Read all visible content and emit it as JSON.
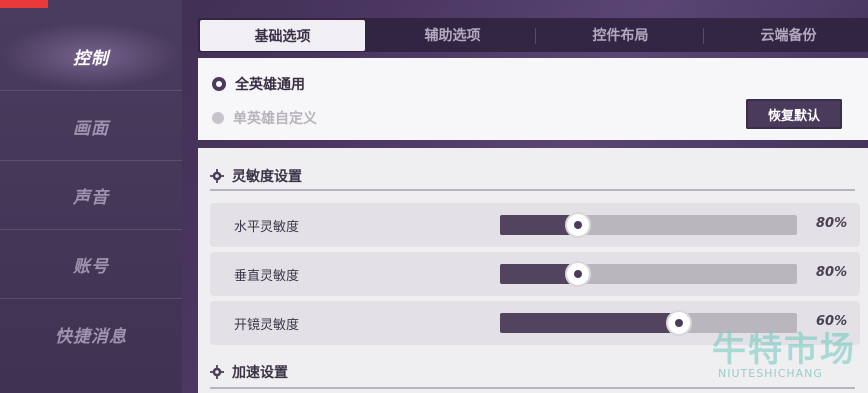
{
  "sidebar": {
    "items": [
      {
        "label": "控制",
        "active": true
      },
      {
        "label": "画面",
        "active": false
      },
      {
        "label": "声音",
        "active": false
      },
      {
        "label": "账号",
        "active": false
      },
      {
        "label": "快捷消息",
        "active": false
      }
    ]
  },
  "tabs": [
    {
      "label": "基础选项",
      "active": true
    },
    {
      "label": "辅助选项",
      "active": false
    },
    {
      "label": "控件布局",
      "active": false
    },
    {
      "label": "云端备份",
      "active": false
    }
  ],
  "mode": {
    "options": [
      {
        "label": "全英雄通用",
        "selected": true
      },
      {
        "label": "单英雄自定义",
        "selected": false
      }
    ],
    "reset_label": "恢复默认"
  },
  "sensitivity": {
    "title": "灵敏度设置",
    "rows": [
      {
        "label": "水平灵敏度",
        "value_text": "80%",
        "fraction": 0.26
      },
      {
        "label": "垂直灵敏度",
        "value_text": "80%",
        "fraction": 0.26
      },
      {
        "label": "开镜灵敏度",
        "value_text": "60%",
        "fraction": 0.6
      }
    ]
  },
  "acceleration": {
    "title": "加速设置"
  },
  "watermark": {
    "cn": "牛特市场",
    "en": "NIUTESHICHANG"
  },
  "colors": {
    "accent": "#4a3b5c",
    "slider_fill": "#52445f",
    "slider_track": "#b9b6bd",
    "topbar_red": "#e83a3a"
  }
}
